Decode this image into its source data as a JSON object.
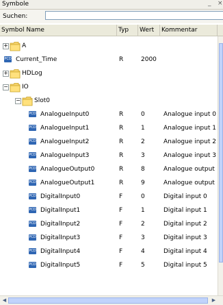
{
  "window": {
    "title": "Symbole",
    "minimize_icon": "minimize-icon",
    "close_icon": "close-icon",
    "minimize_glyph": "_",
    "close_glyph": "×"
  },
  "search": {
    "label": "Suchen:",
    "value": "",
    "placeholder": ""
  },
  "columns": {
    "name": "Symbol Name",
    "type": "Typ",
    "value": "Wert",
    "comment": "Kommentar"
  },
  "icon_text": "PCD",
  "rows": [
    {
      "kind": "folder",
      "expander": "+",
      "name": "A"
    },
    {
      "kind": "symbol",
      "name": "Current_Time",
      "type": "R",
      "value": "2000",
      "comment": ""
    },
    {
      "kind": "folder",
      "expander": "+",
      "name": "HDLog"
    },
    {
      "kind": "folder",
      "expander": "−",
      "name": "IO"
    },
    {
      "kind": "folder",
      "expander": "−",
      "name": "Slot0"
    },
    {
      "kind": "symbol",
      "name": "AnalogueInput0",
      "type": "R",
      "value": "0",
      "comment": "Analogue input 0"
    },
    {
      "kind": "symbol",
      "name": "AnalogueInput1",
      "type": "R",
      "value": "1",
      "comment": "Analogue input 1"
    },
    {
      "kind": "symbol",
      "name": "AnalogueInput2",
      "type": "R",
      "value": "2",
      "comment": "Analogue input 2"
    },
    {
      "kind": "symbol",
      "name": "AnalogueInput3",
      "type": "R",
      "value": "3",
      "comment": "Analogue input 3"
    },
    {
      "kind": "symbol",
      "name": "AnalogueOutput0",
      "type": "R",
      "value": "8",
      "comment": "Analogue output"
    },
    {
      "kind": "symbol",
      "name": "AnalogueOutput1",
      "type": "R",
      "value": "9",
      "comment": "Analogue output"
    },
    {
      "kind": "symbol",
      "name": "DigitalInput0",
      "type": "F",
      "value": "0",
      "comment": "Digital input 0"
    },
    {
      "kind": "symbol",
      "name": "DigitalInput1",
      "type": "F",
      "value": "1",
      "comment": "Digital input 1"
    },
    {
      "kind": "symbol",
      "name": "DigitalInput2",
      "type": "F",
      "value": "2",
      "comment": "Digital input 2"
    },
    {
      "kind": "symbol",
      "name": "DigitalInput3",
      "type": "F",
      "value": "3",
      "comment": "Digital input 3"
    },
    {
      "kind": "symbol",
      "name": "DigitalInput4",
      "type": "F",
      "value": "4",
      "comment": "Digital input 4"
    },
    {
      "kind": "symbol",
      "name": "DigitalInput5",
      "type": "F",
      "value": "5",
      "comment": "Digital input 5"
    }
  ],
  "scrollbars": {
    "left_arrow": "◀",
    "right_arrow": "▶"
  }
}
